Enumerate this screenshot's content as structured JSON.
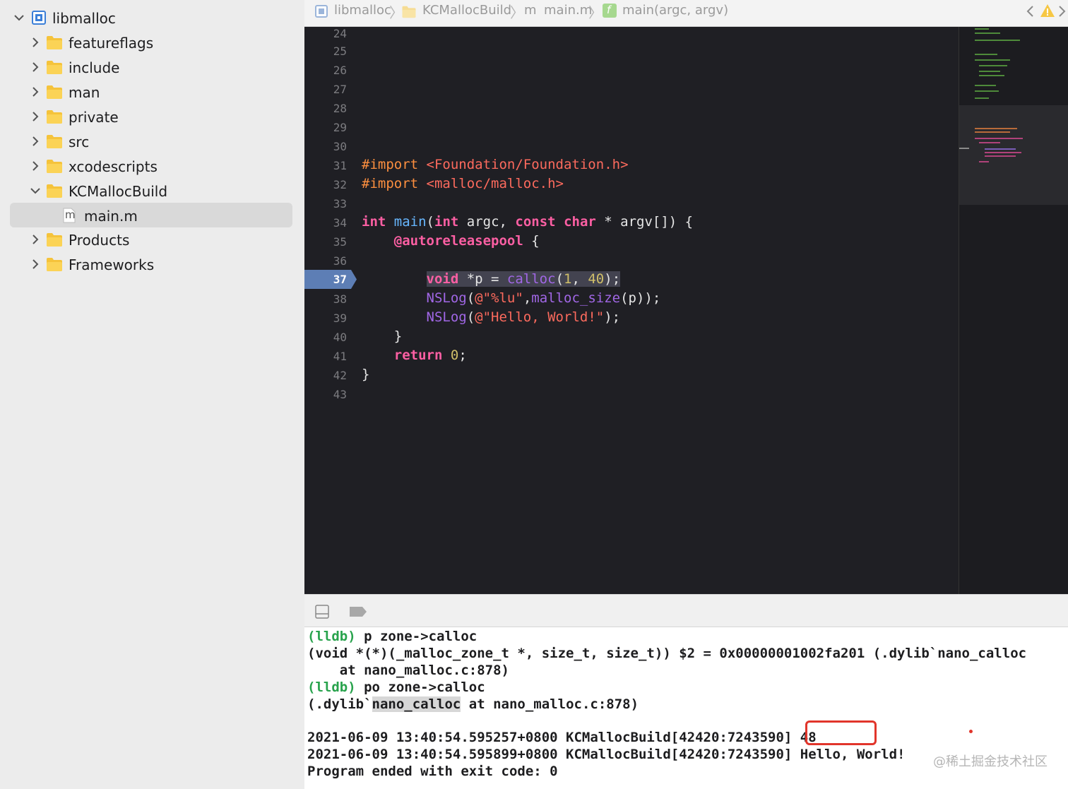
{
  "navigator": {
    "root_label": "libmalloc",
    "items": [
      {
        "label": "featureflags",
        "expanded": false
      },
      {
        "label": "include",
        "expanded": false
      },
      {
        "label": "man",
        "expanded": false
      },
      {
        "label": "private",
        "expanded": false
      },
      {
        "label": "src",
        "expanded": false
      },
      {
        "label": "xcodescripts",
        "expanded": false
      },
      {
        "label": "KCMallocBuild",
        "expanded": true
      },
      {
        "label": "main.m",
        "file_badge": "m",
        "selected": true
      },
      {
        "label": "Products",
        "expanded": false
      },
      {
        "label": "Frameworks",
        "expanded": false
      }
    ]
  },
  "jumpbar": {
    "crumbs": [
      "libmalloc",
      "KCMallocBuild",
      "main.m",
      "main(argc, argv)"
    ],
    "file_badge": "m",
    "func_badge": "f",
    "warning_icon": "warning-triangle-icon"
  },
  "editor": {
    "line_numbers": [
      "24",
      "25",
      "26",
      "27",
      "28",
      "29",
      "30",
      "31",
      "32",
      "33",
      "34",
      "35",
      "36",
      "37",
      "38",
      "39",
      "40",
      "41",
      "42",
      "43"
    ],
    "current_line": "37",
    "code": {
      "l31_a": "#import",
      "l31_b": "<Foundation/Foundation.h>",
      "l32_a": "#import",
      "l32_b": "<malloc/malloc.h>",
      "l34_int": "int",
      "l34_main": "main",
      "l34_paren": "(",
      "l34_int2": "int",
      "l34_argc": " argc, ",
      "l34_const": "const",
      "l34_char": "char",
      "l34_rest": " * argv[]) {",
      "l35_pool": "@autoreleasepool",
      "l35_brace": " {",
      "l37_void": "void",
      "l37_mid": " *p = ",
      "l37_calloc": "calloc",
      "l37_p1": "(",
      "l37_n1": "1",
      "l37_comma": ", ",
      "l37_n2": "40",
      "l37_end": ");",
      "l38_nslog": "NSLog",
      "l38_open": "(",
      "l38_str": "@\"%lu\"",
      "l38_comma": ",",
      "l38_fn": "malloc_size",
      "l38_end": "(p));",
      "l39_nslog": "NSLog",
      "l39_open": "(",
      "l39_str": "@\"Hello, World!\"",
      "l39_end": ");",
      "l40": "}",
      "l41_return": "return",
      "l41_sp": " ",
      "l41_zero": "0",
      "l41_end": ";",
      "l42": "}"
    }
  },
  "console": {
    "lines": [
      {
        "prompt": "(lldb)",
        "text": " p zone->calloc"
      },
      {
        "text": "(void *(*)(_malloc_zone_t *, size_t, size_t)) $2 = 0x00000001002fa201 (.dylib`nano_calloc"
      },
      {
        "text": "    at nano_malloc.c:878)"
      },
      {
        "prompt": "(lldb)",
        "text": " po zone->calloc"
      },
      {
        "pre": "(.dylib`",
        "selected": "nano_calloc",
        "post": " at nano_malloc.c:878)"
      },
      {
        "text": ""
      },
      {
        "text": "2021-06-09 13:40:54.595257+0800 KCMallocBuild[42420:7243590] 48"
      },
      {
        "text": "2021-06-09 13:40:54.595899+0800 KCMallocBuild[42420:7243590] Hello, World!"
      },
      {
        "text": "Program ended with exit code: 0"
      }
    ],
    "watermark": "@稀土掘金技术社区"
  },
  "colors": {
    "editor_bg": "#1f1f24",
    "keyword": "#fc5fa3",
    "preprocessor": "#fd8f3f",
    "function": "#67b7ff",
    "string": "#fc6a5d",
    "number": "#d0bf69",
    "console_prompt": "#29a34d",
    "annotation_red": "#e1352b",
    "current_line_marker": "#5d7eb5"
  }
}
